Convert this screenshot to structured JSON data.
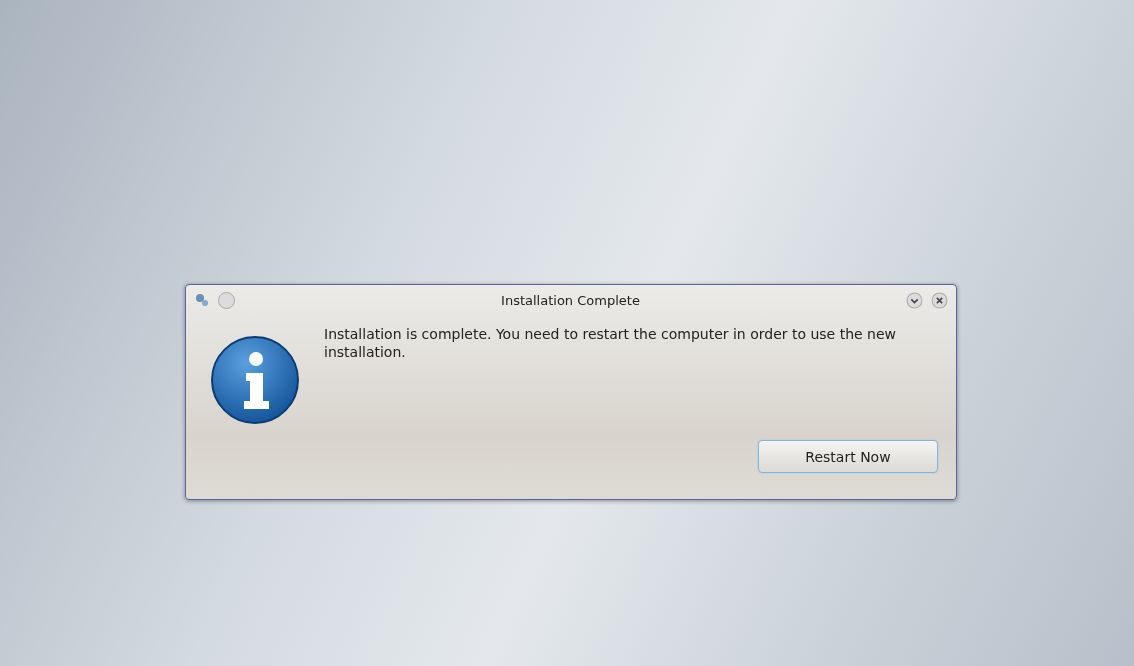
{
  "dialog": {
    "title": "Installation Complete",
    "message": "Installation is complete. You need to restart the computer in order to use the new installation.",
    "buttons": [
      "Restart Now"
    ]
  }
}
